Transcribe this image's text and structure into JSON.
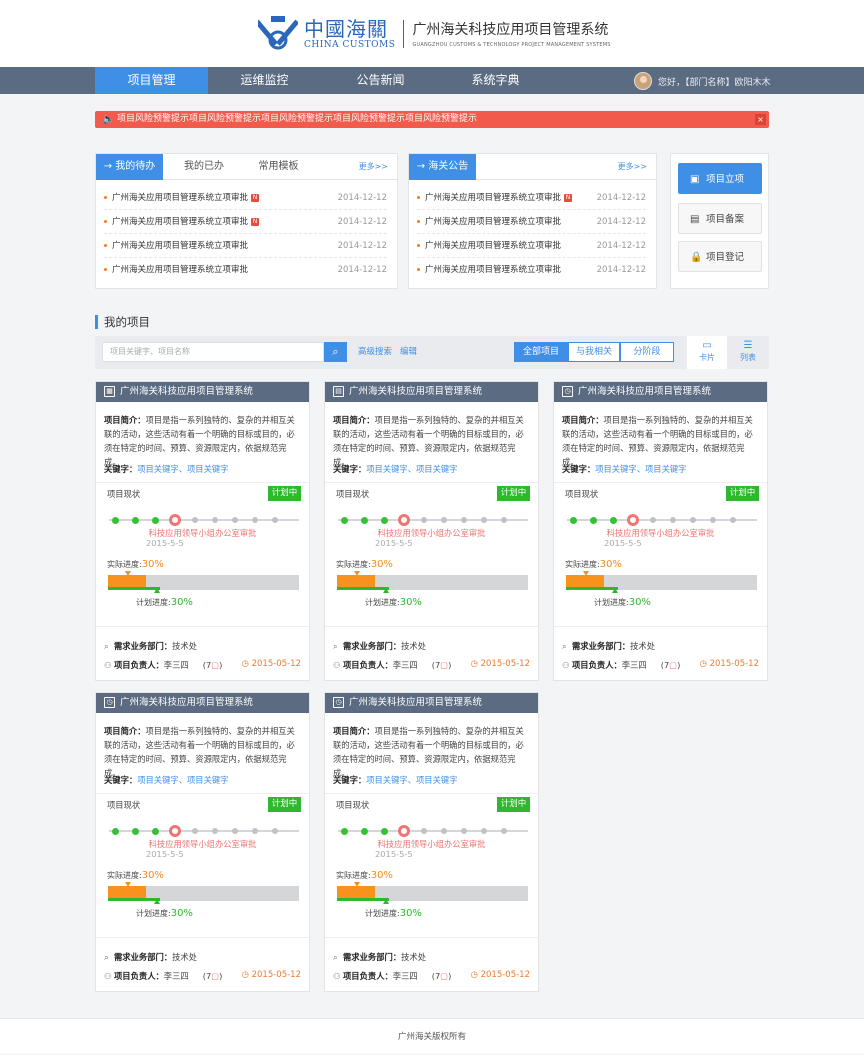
{
  "header": {
    "logo_cn": "中國海關",
    "logo_en": "CHINA CUSTOMS",
    "system_title": "广州海关科技应用项目管理系统",
    "system_title_en": "GUANGZHOU CUSTOMS & TECHNOLOGY PROJECT MANAGEMENT SYSTEMS"
  },
  "nav": {
    "items": [
      {
        "label": "项目管理",
        "active": true
      },
      {
        "label": "运维监控",
        "active": false
      },
      {
        "label": "公告新闻",
        "active": false
      },
      {
        "label": "系统字典",
        "active": false
      }
    ],
    "user_greeting": "您好，【部门名称】欧阳木木"
  },
  "alert": {
    "text": "项目风险预警提示项目风险预警提示项目风险预警提示项目风险预警提示项目风险预警提示",
    "close": "×"
  },
  "todo_panel": {
    "tabs": [
      "我的待办",
      "我的已办",
      "常用模板"
    ],
    "more": "更多>>",
    "rows": [
      {
        "text": "广州海关应用项目管理系统立项审批",
        "new": "N",
        "date": "2014-12-12"
      },
      {
        "text": "广州海关应用项目管理系统立项审批",
        "new": "N",
        "date": "2014-12-12"
      },
      {
        "text": "广州海关应用项目管理系统立项审批",
        "new": "",
        "date": "2014-12-12"
      },
      {
        "text": "广州海关应用项目管理系统立项审批",
        "new": "",
        "date": "2014-12-12"
      }
    ]
  },
  "notice_panel": {
    "tab": "海关公告",
    "more": "更多>>",
    "rows": [
      {
        "text": "广州海关应用项目管理系统立项审批",
        "new": "N",
        "date": "2014-12-12"
      },
      {
        "text": "广州海关应用项目管理系统立项审批",
        "new": "",
        "date": "2014-12-12"
      },
      {
        "text": "广州海关应用项目管理系统立项审批",
        "new": "",
        "date": "2014-12-12"
      },
      {
        "text": "广州海关应用项目管理系统立项审批",
        "new": "",
        "date": "2014-12-12"
      }
    ]
  },
  "quick_actions": [
    {
      "label": "项目立项",
      "icon": "folder-icon",
      "primary": true
    },
    {
      "label": "项目备案",
      "icon": "list-icon",
      "primary": false
    },
    {
      "label": "项目登记",
      "icon": "lock-icon",
      "primary": false
    }
  ],
  "projects_section": {
    "title": "我的项目",
    "search_placeholder": "项目关键字、项目名称",
    "advanced_search": "高级搜索",
    "edit": "编辑",
    "filters": [
      {
        "label": "全部项目",
        "active": true
      },
      {
        "label": "与我相关",
        "active": false
      },
      {
        "label": "分阶段",
        "active": false
      }
    ],
    "views": [
      {
        "label": "卡片",
        "active": true
      },
      {
        "label": "列表",
        "active": false
      }
    ]
  },
  "cards": [
    {
      "title": "广州海关科技应用项目管理系统",
      "icon": "calendar-icon"
    },
    {
      "title": "广州海关科技应用项目管理系统",
      "icon": "document-icon"
    },
    {
      "title": "广州海关科技应用项目管理系统",
      "icon": "clock-icon"
    },
    {
      "title": "广州海关科技应用项目管理系统",
      "icon": "clock-icon"
    },
    {
      "title": "广州海关科技应用项目管理系统",
      "icon": "clock-icon"
    }
  ],
  "card_common": {
    "intro_label": "项目简介：",
    "intro_text": "项目是指一系列独特的、复杂的并相互关联的活动，这些活动有着一个明确的目标或目的，必须在特定的时间、预算、资源限定内，依据规范完成。",
    "keywords_label": "关键字：",
    "keywords": "项目关键字、项目关键字",
    "status_label": "项目现状",
    "status_badge": "计划中",
    "steps_total": 9,
    "steps_done": 3,
    "current_step": 4,
    "stage_text": "科技应用领导小组办公室审批",
    "stage_date": "2015-5-5",
    "actual_label": "实际进度:",
    "actual_value": "30%",
    "plan_label": "计划进度:",
    "plan_value": "30%",
    "actual_fraction": 0.2,
    "plan_fraction": 0.27,
    "dept_label": "需求业务部门：",
    "dept": "技术处",
    "owner_label": "项目负责人：",
    "owner": "李三四",
    "count": "7",
    "date": "2015-05-12"
  },
  "footer": {
    "copyright": "广州海关版权所有"
  },
  "colors": {
    "accent": "#3f8fe6",
    "nav_bg": "#5b6b82",
    "alert": "#f25b4b",
    "success": "#2db82d",
    "progress": "#f7921e"
  }
}
